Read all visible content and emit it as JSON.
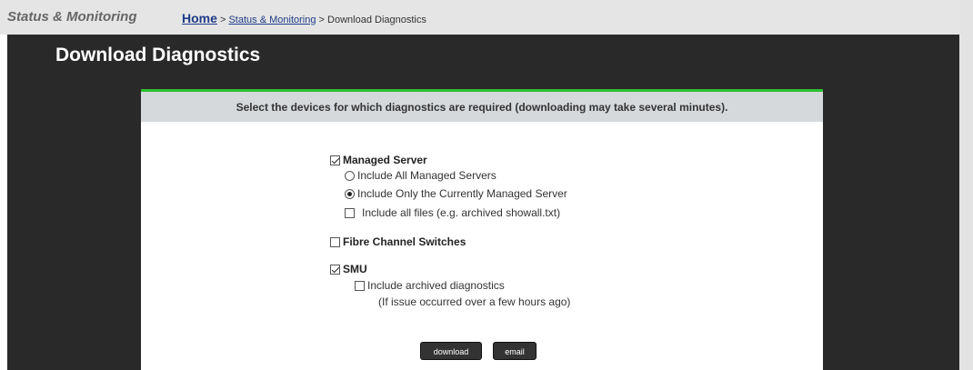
{
  "topbar": {
    "section_title": "Status & Monitoring",
    "breadcrumb": {
      "home": "Home",
      "sep1": ">",
      "status_link": "Status & Monitoring",
      "sep2": ">",
      "current": "Download Diagnostics"
    }
  },
  "page": {
    "title": "Download Diagnostics"
  },
  "panel": {
    "header": "Select the devices for which diagnostics are required (downloading may take several minutes).",
    "managed_server": {
      "label": "Managed Server",
      "checked": true,
      "options": [
        {
          "label": "Include All Managed Servers",
          "selected": false
        },
        {
          "label": "Include Only the Currently Managed Server",
          "selected": true
        }
      ],
      "include_all_files": {
        "label": "Include all files (e.g. archived showall.txt)",
        "checked": false
      }
    },
    "fibre_channel": {
      "label": "Fibre Channel Switches",
      "checked": false
    },
    "smu": {
      "label": "SMU",
      "checked": true,
      "archived": {
        "label": "Include archived diagnostics",
        "checked": false,
        "note": "(If issue occurred over a few hours ago)"
      }
    },
    "buttons": {
      "download": "download",
      "email": "email"
    }
  }
}
